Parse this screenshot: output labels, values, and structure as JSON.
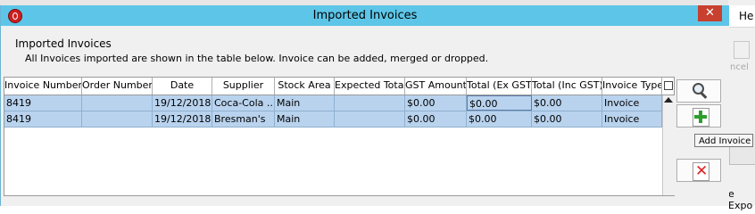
{
  "background": {
    "menu_label": "He",
    "cancel_label": "ncel",
    "export_label": "e Expo"
  },
  "dialog": {
    "title": "Imported Invoices",
    "heading": "Imported Invoices",
    "subtitle": "All Invoices imported are shown in the table below.  Invoice can be added, merged or dropped.",
    "close_label": "✕"
  },
  "table": {
    "columns": [
      "Invoice Number",
      "Order Number",
      "Date",
      "Supplier",
      "Stock Area",
      "Expected Total",
      "GST Amount",
      "Total (Ex GST)",
      "Total (Inc GST)",
      "Invoice Type"
    ],
    "rows": [
      [
        "8419",
        "",
        "19/12/2018",
        "Coca-Cola ...",
        "Main",
        "",
        "$0.00",
        "$0.00",
        "$0.00",
        "Invoice"
      ],
      [
        "8419",
        "",
        "19/12/2018",
        "Bresman's",
        "Main",
        "",
        "$0.00",
        "$0.00",
        "$0.00",
        "Invoice"
      ]
    ]
  },
  "side_buttons": {
    "view_icon": "magnifier-icon",
    "add_icon": "add-document-icon",
    "delete_icon": "delete-document-icon",
    "tooltip": "Add Invoice"
  },
  "colors": {
    "titlebar": "#5dc6e8",
    "close_button": "#c8402f",
    "row_selected": "#b9d3ee"
  }
}
